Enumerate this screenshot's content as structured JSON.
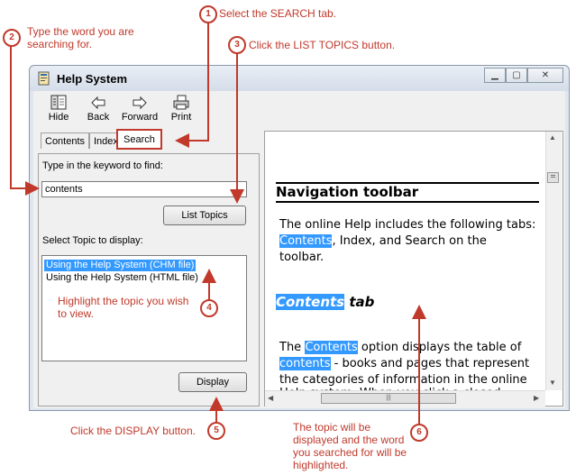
{
  "annotations": {
    "step1": {
      "num": "1",
      "text": "Select the SEARCH tab."
    },
    "step2": {
      "num": "2",
      "text_line1": "Type the word you are",
      "text_line2": "searching for."
    },
    "step3": {
      "num": "3",
      "text": "Click the LIST TOPICS button."
    },
    "step4": {
      "num": "4",
      "text_line1": "Highlight the topic you wish",
      "text_line2": "to view."
    },
    "step5": {
      "num": "5",
      "text": "Click the DISPLAY button."
    },
    "step6": {
      "num": "6",
      "text_line1": "The topic will be",
      "text_line2": "displayed and the word",
      "text_line3": "you searched for will be",
      "text_line4": "highlighted."
    }
  },
  "window": {
    "title": "Help System"
  },
  "toolbar": {
    "hide": "Hide",
    "back": "Back",
    "forward": "Forward",
    "print": "Print"
  },
  "tabs": {
    "contents": "Contents",
    "index": "Index",
    "search": "Search"
  },
  "search": {
    "keyword_label": "Type in the keyword to find:",
    "keyword_value": "contents",
    "list_topics_button": "List Topics",
    "select_label": "Select Topic to display:",
    "topics": [
      "Using the  Help System (CHM file)",
      "Using the  Help System (HTML file)"
    ],
    "display_button": "Display"
  },
  "document": {
    "heading": "Navigation toolbar",
    "para1_line1": "The online Help includes the following tabs:",
    "para1_hl": "Contents",
    "para1_line2_rest": ", Index, and Search on the",
    "para1_line3": "toolbar.",
    "subheading_hl": "Contents",
    "subheading_rest": " tab",
    "para2_pre": "The ",
    "para2_hl1": "Contents",
    "para2_line1_rest": " option displays the table of",
    "para2_hl2": "contents",
    "para2_line2_rest": " - books and pages that represent",
    "para2_line3": "the categories of information in the online",
    "para2_line4": "Help system. When you click a closed"
  },
  "colors": {
    "annotation": "#c0392b",
    "highlight": "#3399ff"
  }
}
